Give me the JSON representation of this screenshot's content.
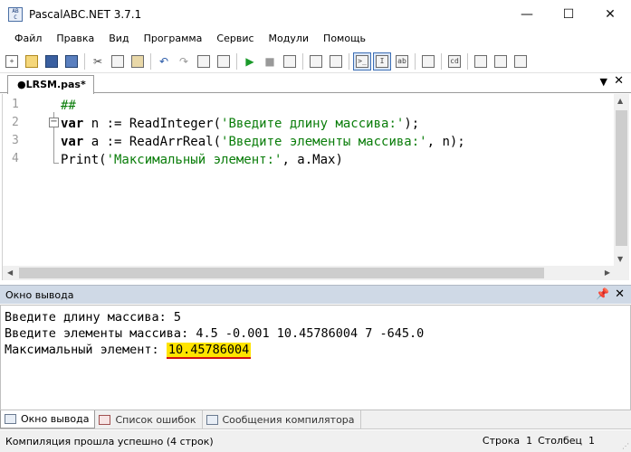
{
  "window": {
    "title": "PascalABC.NET 3.7.1",
    "icon_text": "AB\nC"
  },
  "menu": [
    "Файл",
    "Правка",
    "Вид",
    "Программа",
    "Сервис",
    "Модули",
    "Помощь"
  ],
  "tabs": {
    "active_file": "●LRSM.pas*"
  },
  "editor": {
    "line_numbers": [
      "1",
      "2",
      "3",
      "4"
    ],
    "lines": [
      {
        "comment": "##"
      },
      {
        "kw": "var",
        "code": " n := ReadInteger(",
        "str": "'Введите длину массива:'",
        "tail": ");"
      },
      {
        "kw": "var",
        "code": " a := ReadArrReal(",
        "str": "'Введите элементы массива:'",
        "tail": ", n);"
      },
      {
        "code": "Print(",
        "str": "'Максимальный элемент:'",
        "tail": ", a.Max)"
      }
    ]
  },
  "output_panel": {
    "title": "Окно вывода",
    "lines": [
      "Введите длину массива: 5",
      "Введите элементы массива: 4.5 -0.001 10.45786004 7 -645.0"
    ],
    "result_label": "Максимальный элемент: ",
    "result_value": "10.45786004"
  },
  "bottom_tabs": [
    "Окно вывода",
    "Список ошибок",
    "Сообщения компилятора"
  ],
  "status": {
    "message": "Компиляция прошла успешно (4 строк)",
    "row_label": "Строка",
    "row_value": "1",
    "col_label": "Столбец",
    "col_value": "1"
  }
}
